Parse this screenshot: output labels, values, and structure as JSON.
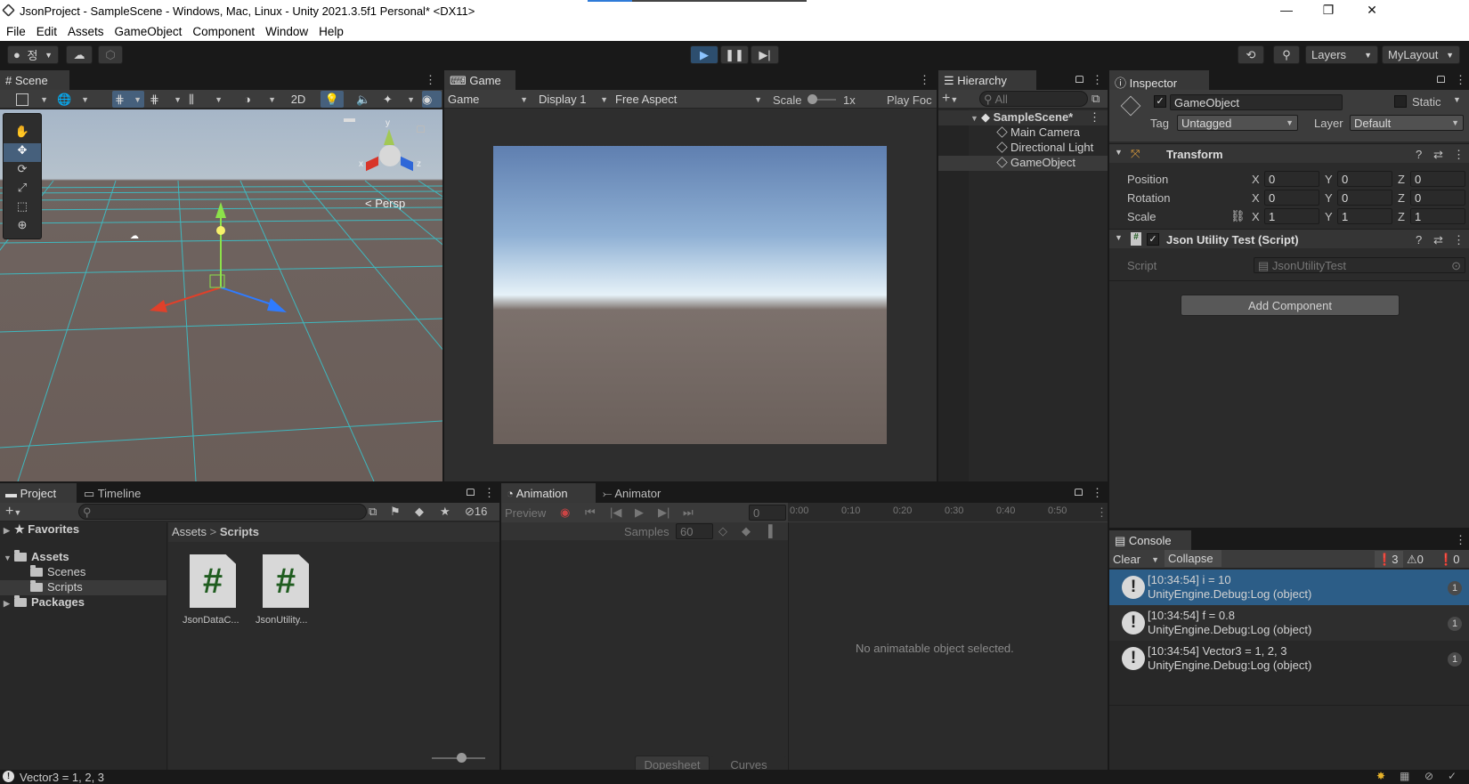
{
  "window": {
    "title": "JsonProject - SampleScene - Windows, Mac, Linux - Unity 2021.3.5f1 Personal* <DX11>"
  },
  "menu": [
    "File",
    "Edit",
    "Assets",
    "GameObject",
    "Component",
    "Window",
    "Help"
  ],
  "toolbar": {
    "account": "정",
    "layers": "Layers",
    "layout": "MyLayout"
  },
  "scene": {
    "tab": "Scene",
    "mode2d": "2D",
    "persp": "Persp",
    "gizmo_y": "y",
    "gizmo_x": "x",
    "gizmo_z": "z"
  },
  "game": {
    "tab": "Game",
    "view": "Game",
    "display": "Display 1",
    "aspect": "Free Aspect",
    "scale_label": "Scale",
    "scale_value": "1x",
    "play_focus": "Play Foc"
  },
  "hierarchy": {
    "tab": "Hierarchy",
    "search": "All",
    "scene": "SampleScene*",
    "items": [
      "Main Camera",
      "Directional Light",
      "GameObject"
    ]
  },
  "inspector": {
    "tab": "Inspector",
    "name": "GameObject",
    "static": "Static",
    "tag_label": "Tag",
    "tag": "Untagged",
    "layer_label": "Layer",
    "layer": "Default",
    "transform": "Transform",
    "rows": [
      {
        "label": "Position",
        "x": "0",
        "y": "0",
        "z": "0"
      },
      {
        "label": "Rotation",
        "x": "0",
        "y": "0",
        "z": "0"
      },
      {
        "label": "Scale",
        "x": "1",
        "y": "1",
        "z": "1"
      }
    ],
    "axis": {
      "x": "X",
      "y": "Y",
      "z": "Z"
    },
    "script_component": "Json Utility Test (Script)",
    "script_label": "Script",
    "script_value": "JsonUtilityTest",
    "add_component": "Add Component"
  },
  "project": {
    "tab": "Project",
    "tab2": "Timeline",
    "hidden_count": "16",
    "tree": {
      "favorites": "Favorites",
      "assets": "Assets",
      "scenes": "Scenes",
      "scripts": "Scripts",
      "packages": "Packages"
    },
    "breadcrumb": [
      "Assets",
      "Scripts"
    ],
    "files": [
      "JsonDataC...",
      "JsonUtility..."
    ]
  },
  "animation": {
    "tab": "Animation",
    "tab2": "Animator",
    "preview": "Preview",
    "frame": "0",
    "samples_label": "Samples",
    "samples": "60",
    "ticks": [
      "0:00",
      "0:10",
      "0:20",
      "0:30",
      "0:40",
      "0:50"
    ],
    "empty": "No animatable object selected.",
    "dopesheet": "Dopesheet",
    "curves": "Curves"
  },
  "console": {
    "tab": "Console",
    "clear": "Clear",
    "collapse": "Collapse",
    "counts": {
      "log": "3",
      "warn": "0",
      "error": "0"
    },
    "logs": [
      {
        "msg": "[10:34:54] i = 10",
        "src": "UnityEngine.Debug:Log (object)",
        "count": "1"
      },
      {
        "msg": "[10:34:54] f = 0.8",
        "src": "UnityEngine.Debug:Log (object)",
        "count": "1"
      },
      {
        "msg": "[10:34:54] Vector3 = 1, 2, 3",
        "src": "UnityEngine.Debug:Log (object)",
        "count": "1"
      }
    ]
  },
  "status": {
    "text": "Vector3 = 1, 2, 3"
  }
}
